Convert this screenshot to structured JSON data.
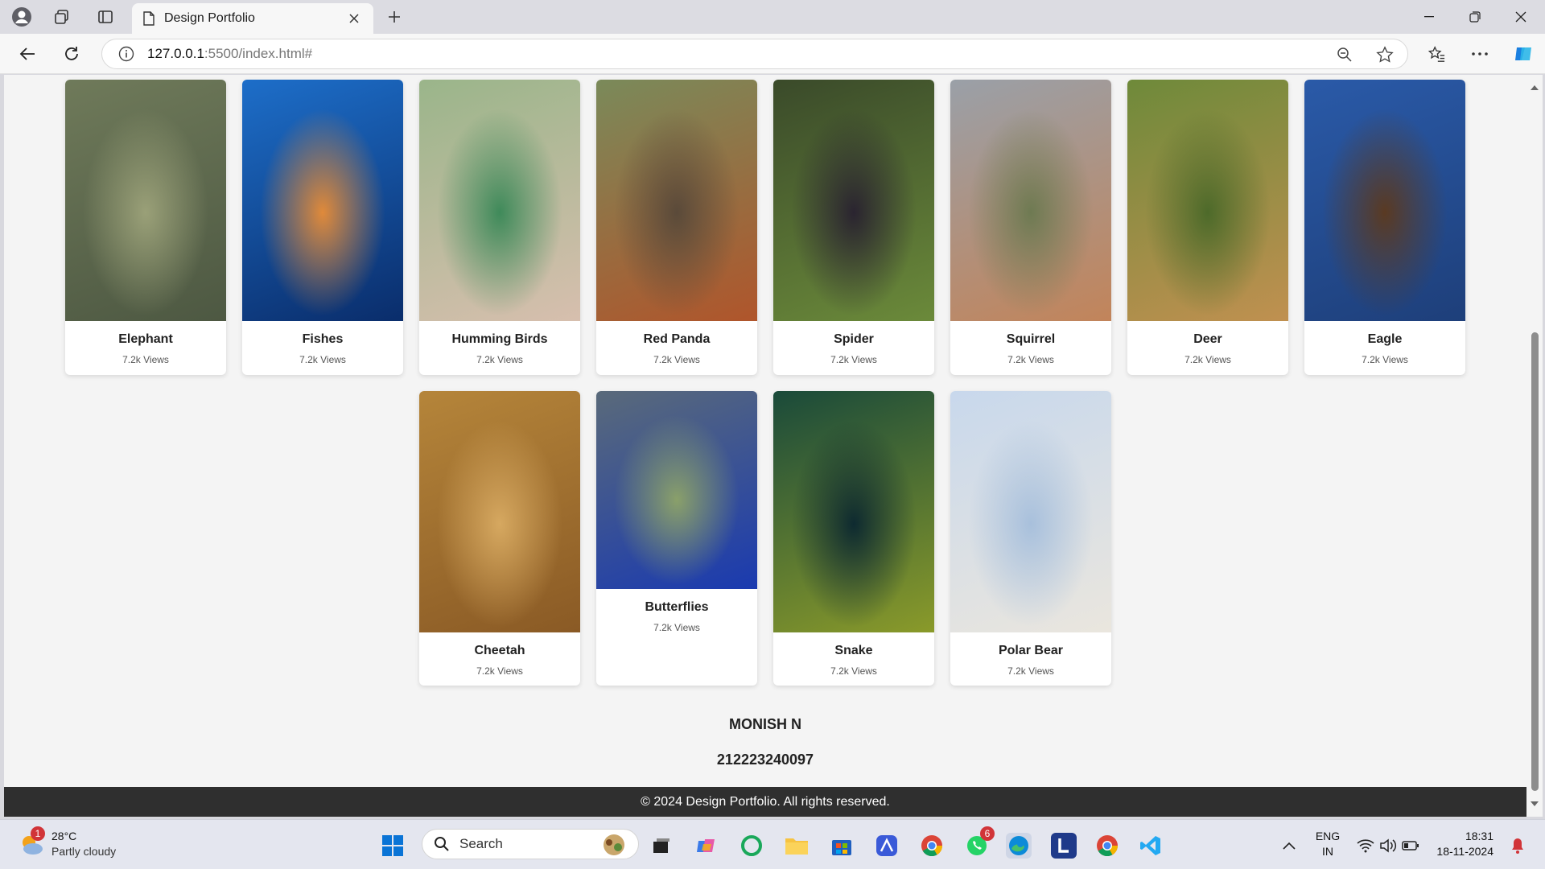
{
  "browser": {
    "tab_title": "Design Portfolio",
    "url_host": "127.0.0.1",
    "url_rest": ":5500/index.html#"
  },
  "gallery": {
    "row1": [
      {
        "name": "Elephant",
        "views": "7.2k Views",
        "palette": [
          "#6f7a5a",
          "#4d5842",
          "#9aa078"
        ]
      },
      {
        "name": "Fishes",
        "views": "7.2k Views",
        "palette": [
          "#1d6ec9",
          "#0a2d6b",
          "#e08a3a"
        ]
      },
      {
        "name": "Humming Birds",
        "views": "7.2k Views",
        "palette": [
          "#9ab58a",
          "#d7bfae",
          "#3f8a5a"
        ]
      },
      {
        "name": "Red Panda",
        "views": "7.2k Views",
        "palette": [
          "#7a8a5a",
          "#b0552b",
          "#5a4a3a"
        ]
      },
      {
        "name": "Spider",
        "views": "7.2k Views",
        "palette": [
          "#3a4a2a",
          "#6b8a3a",
          "#2a2430"
        ]
      },
      {
        "name": "Squirrel",
        "views": "7.2k Views",
        "palette": [
          "#9aa0a8",
          "#c2845a",
          "#6e7a52"
        ]
      },
      {
        "name": "Deer",
        "views": "7.2k Views",
        "palette": [
          "#6e8a3a",
          "#c09050",
          "#4d6a2a"
        ]
      },
      {
        "name": "Eagle",
        "views": "7.2k Views",
        "palette": [
          "#2a5aa8",
          "#1e3f7a",
          "#5a3a22"
        ]
      }
    ],
    "row2": [
      {
        "name": "Cheetah",
        "views": "7.2k Views",
        "palette": [
          "#b5853a",
          "#8a5a25",
          "#d6a860"
        ]
      },
      {
        "name": "Butterflies",
        "views": "7.2k Views",
        "palette": [
          "#5a6a7a",
          "#1a3ab0",
          "#8aa06a"
        ]
      },
      {
        "name": "Snake",
        "views": "7.2k Views",
        "palette": [
          "#1a4a3a",
          "#8a9a2a",
          "#0e2a30"
        ]
      },
      {
        "name": "Polar Bear",
        "views": "7.2k Views",
        "palette": [
          "#c8d8ec",
          "#eae6de",
          "#a8c0dc"
        ]
      }
    ]
  },
  "author": {
    "name": "MONISH N",
    "id": "212223240097"
  },
  "footer": "© 2024 Design Portfolio. All rights reserved.",
  "taskbar": {
    "weather_temp": "28°C",
    "weather_cond": "Partly cloudy",
    "weather_badge": "1",
    "search_label": "Search",
    "whatsapp_badge": "6",
    "lang_line1": "ENG",
    "lang_line2": "IN",
    "time": "18:31",
    "date": "18-11-2024"
  },
  "colors": {
    "footer_bg": "#2f2f2f",
    "accent": "#0067c0",
    "badge": "#d13438"
  }
}
